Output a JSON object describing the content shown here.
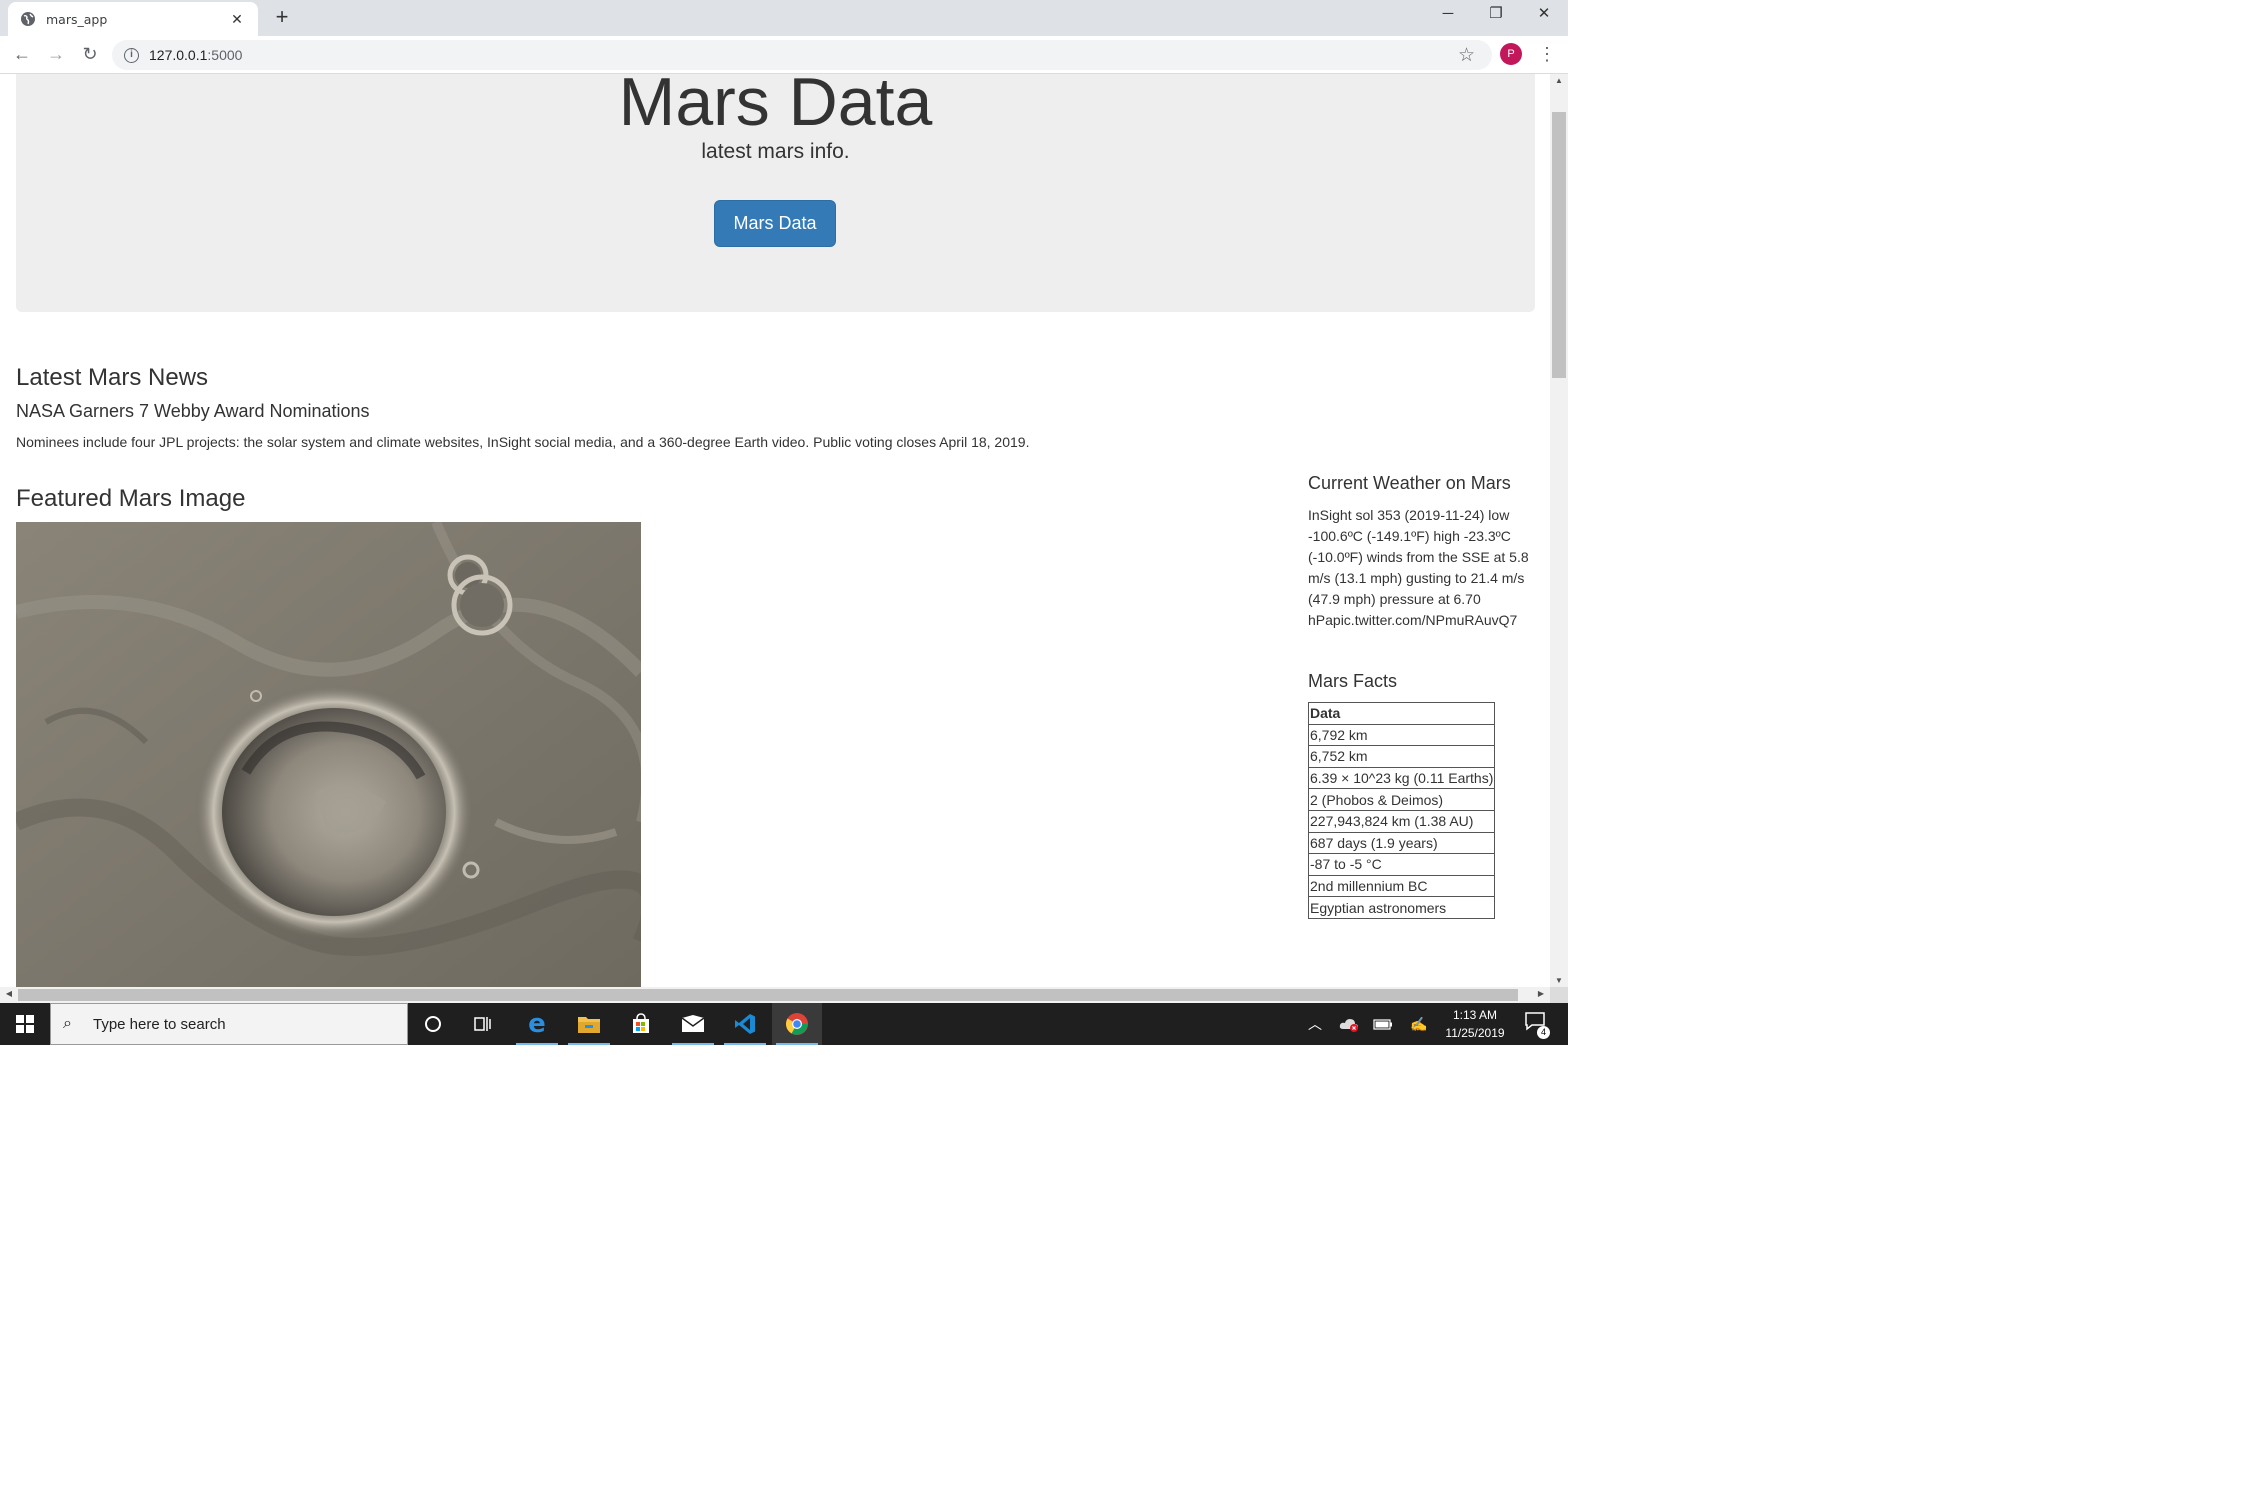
{
  "browser": {
    "tab_title": "mars_app",
    "url_host": "127.0.0.1",
    "url_port": ":5000",
    "profile_initial": "P"
  },
  "jumbotron": {
    "title": "Mars Data",
    "lead": "latest mars info.",
    "button_label": "Mars Data",
    "button_color": "#337ab7"
  },
  "news": {
    "heading": "Latest Mars News",
    "title": "NASA Garners 7 Webby Award Nominations",
    "paragraph": "Nominees include four JPL projects: the solar system and climate websites, InSight social media, and a 360-degree Earth video. Public voting closes April 18, 2019."
  },
  "featured_image": {
    "heading": "Featured Mars Image"
  },
  "weather": {
    "heading": "Current Weather on Mars",
    "text": "InSight sol 353 (2019-11-24) low -100.6ºC (-149.1ºF) high -23.3ºC (-10.0ºF) winds from the SSE at 5.8 m/s (13.1 mph) gusting to 21.4 m/s (47.9 mph) pressure at 6.70 hPapic.twitter.com/NPmuRAuvQ7"
  },
  "facts": {
    "heading": "Mars Facts",
    "column_header": "Data",
    "rows": [
      "6,792 km",
      "6,752 km",
      "6.39 × 10^23 kg (0.11 Earths)",
      "2 (Phobos & Deimos)",
      "227,943,824 km (1.38 AU)",
      "687 days (1.9 years)",
      "-87 to -5 °C",
      "2nd millennium BC",
      "Egyptian astronomers"
    ]
  },
  "taskbar": {
    "search_placeholder": "Type here to search",
    "time": "1:13 AM",
    "date": "11/25/2019",
    "notification_count": "4"
  }
}
